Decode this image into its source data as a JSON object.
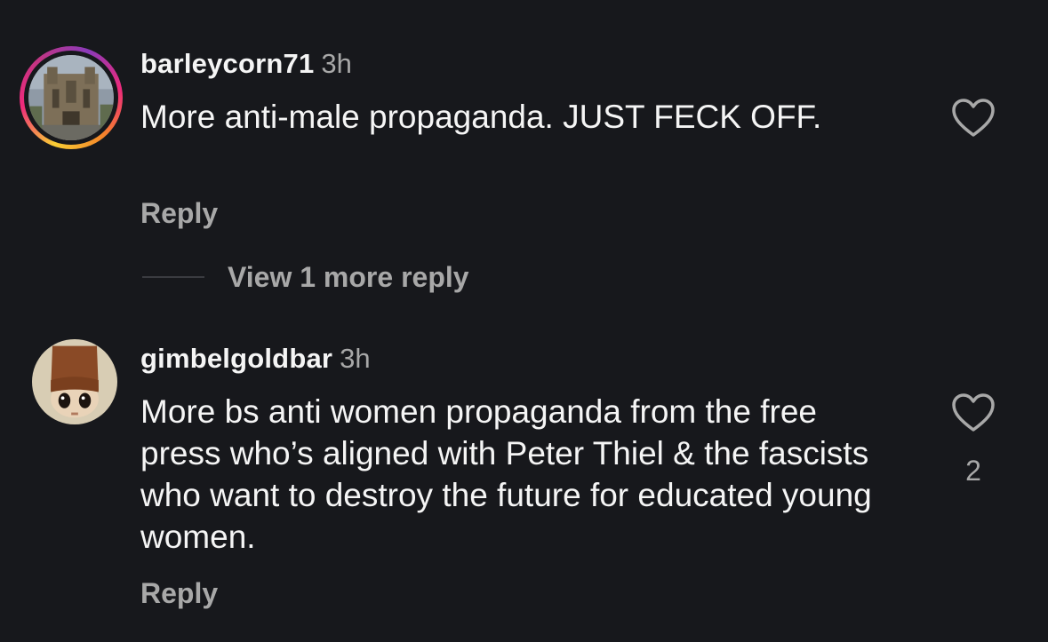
{
  "comments": [
    {
      "username": "barleycorn71",
      "time": "3h",
      "text": "More anti-male propaganda. JUST FECK OFF.",
      "reply_label": "Reply",
      "like_count": "",
      "has_story_ring": true,
      "avatar_icon": "cathedral-avatar"
    },
    {
      "username": "gimbelgoldbar",
      "time": "3h",
      "text": "More bs anti women propaganda from the free press who’s aligned with Peter Thiel & the fascists who want to destroy the future for educated young women.",
      "reply_label": "Reply",
      "like_count": "2",
      "has_story_ring": false,
      "avatar_icon": "doll-avatar"
    }
  ],
  "view_more_replies": "View 1 more reply",
  "colors": {
    "background": "#17181c",
    "primary_text": "#f5f5f5",
    "secondary_text": "#a8a8a8"
  }
}
